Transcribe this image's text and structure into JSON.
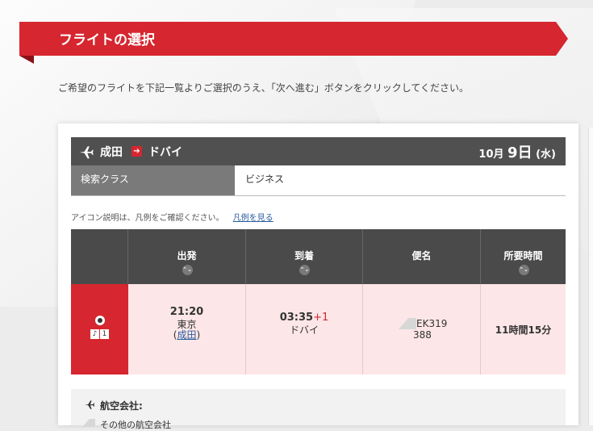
{
  "header": {
    "title": "フライトの選択"
  },
  "intro": "ご希望のフライトを下記一覧よりご選択のうえ、「次へ進む」ボタンをクリックしてください。",
  "route": {
    "from": "成田",
    "to": "ドバイ",
    "arrow": "➔",
    "date_month": "10月",
    "date_day": "9日",
    "date_weekday": "(水)"
  },
  "class": {
    "label": "検索クラス",
    "value": "ビジネス"
  },
  "legend": {
    "note": "アイコン説明は、凡例をご確認ください。",
    "link": "凡例を見る"
  },
  "table": {
    "headers": [
      "出発",
      "到着",
      "便名",
      "所要時間"
    ],
    "sort_glyph": "⌃⌄",
    "row": {
      "dep_time": "21:20",
      "dep_city": "東京",
      "dep_airport_open": "(",
      "dep_airport": "成田",
      "dep_airport_close": ")",
      "arr_time": "03:35",
      "arr_plus": "+1",
      "arr_city": "ドバイ",
      "flight_no": "EK319",
      "aircraft": "388",
      "duration": "11時間15分",
      "icon_music": "♪",
      "icon_num": "1"
    }
  },
  "airline": {
    "label": "航空会社:",
    "sub": "その他の航空会社"
  },
  "colors": {
    "accent": "#d6262f",
    "header_dark": "#505050",
    "row_pink": "#fde6e7"
  }
}
